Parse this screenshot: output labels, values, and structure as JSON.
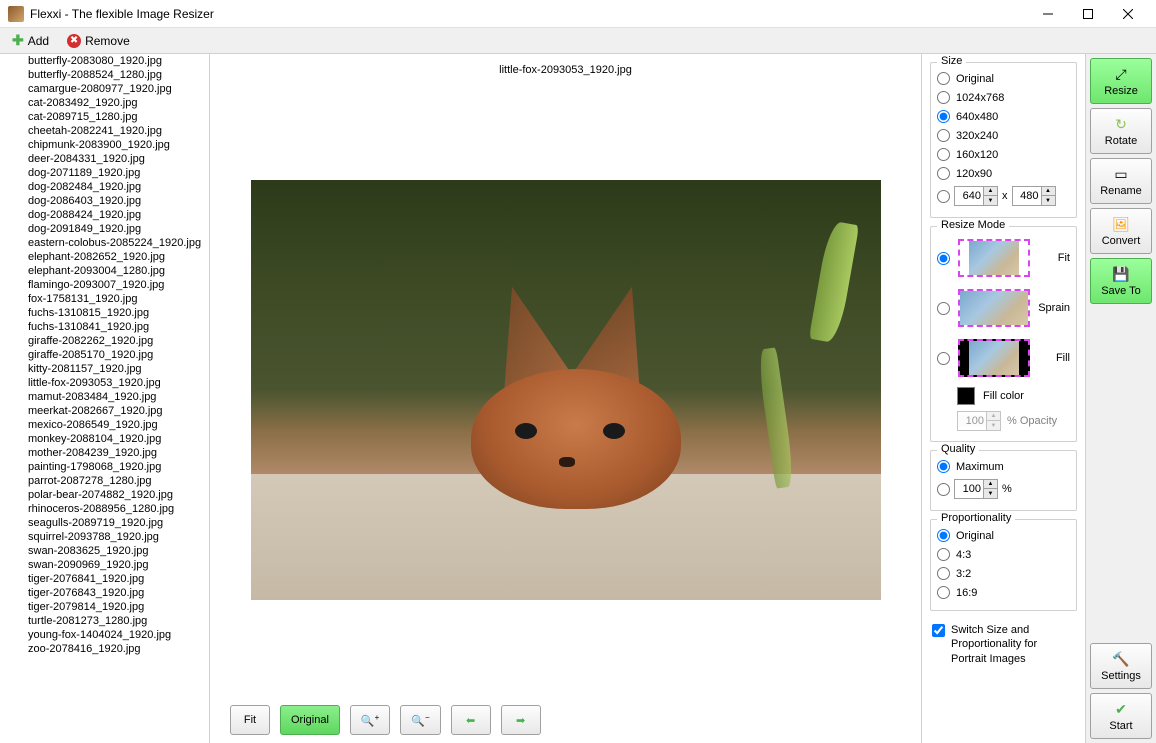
{
  "window": {
    "title": "Flexxi - The flexible Image Resizer"
  },
  "toolbar": {
    "add_label": "Add",
    "remove_label": "Remove"
  },
  "files": [
    "butterfly-2083080_1920.jpg",
    "butterfly-2088524_1280.jpg",
    "camargue-2080977_1920.jpg",
    "cat-2083492_1920.jpg",
    "cat-2089715_1280.jpg",
    "cheetah-2082241_1920.jpg",
    "chipmunk-2083900_1920.jpg",
    "deer-2084331_1920.jpg",
    "dog-2071189_1920.jpg",
    "dog-2082484_1920.jpg",
    "dog-2086403_1920.jpg",
    "dog-2088424_1920.jpg",
    "dog-2091849_1920.jpg",
    "eastern-colobus-2085224_1920.jpg",
    "elephant-2082652_1920.jpg",
    "elephant-2093004_1280.jpg",
    "flamingo-2093007_1920.jpg",
    "fox-1758131_1920.jpg",
    "fuchs-1310815_1920.jpg",
    "fuchs-1310841_1920.jpg",
    "giraffe-2082262_1920.jpg",
    "giraffe-2085170_1920.jpg",
    "kitty-2081157_1920.jpg",
    "little-fox-2093053_1920.jpg",
    "mamut-2083484_1920.jpg",
    "meerkat-2082667_1920.jpg",
    "mexico-2086549_1920.jpg",
    "monkey-2088104_1920.jpg",
    "mother-2084239_1920.jpg",
    "painting-1798068_1920.jpg",
    "parrot-2087278_1280.jpg",
    "polar-bear-2074882_1920.jpg",
    "rhinoceros-2088956_1280.jpg",
    "seagulls-2089719_1920.jpg",
    "squirrel-2093788_1920.jpg",
    "swan-2083625_1920.jpg",
    "swan-2090969_1920.jpg",
    "tiger-2076841_1920.jpg",
    "tiger-2076843_1920.jpg",
    "tiger-2079814_1920.jpg",
    "turtle-2081273_1280.jpg",
    "young-fox-1404024_1920.jpg",
    "zoo-2078416_1920.jpg"
  ],
  "preview": {
    "filename": "little-fox-2093053_1920.jpg",
    "fit_label": "Fit",
    "original_label": "Original"
  },
  "size": {
    "title": "Size",
    "options": [
      "Original",
      "1024x768",
      "640x480",
      "320x240",
      "160x120",
      "120x90"
    ],
    "selected": "640x480",
    "custom_w": "640",
    "custom_h": "480",
    "x_label": "x"
  },
  "resize_mode": {
    "title": "Resize Mode",
    "fit": "Fit",
    "sprain": "Sprain",
    "fill": "Fill",
    "selected": "Fit",
    "fill_color_label": "Fill color",
    "opacity_value": "100",
    "opacity_label": "% Opacity"
  },
  "quality": {
    "title": "Quality",
    "maximum": "Maximum",
    "selected": "Maximum",
    "custom_value": "100",
    "pct": "%"
  },
  "proportionality": {
    "title": "Proportionality",
    "options": [
      "Original",
      "4:3",
      "3:2",
      "16:9"
    ],
    "selected": "Original"
  },
  "switch_label": "Switch Size and Proportionality for Portrait Images",
  "actions": {
    "resize": "Resize",
    "rotate": "Rotate",
    "rename": "Rename",
    "convert": "Convert",
    "saveto": "Save To",
    "settings": "Settings",
    "start": "Start"
  }
}
